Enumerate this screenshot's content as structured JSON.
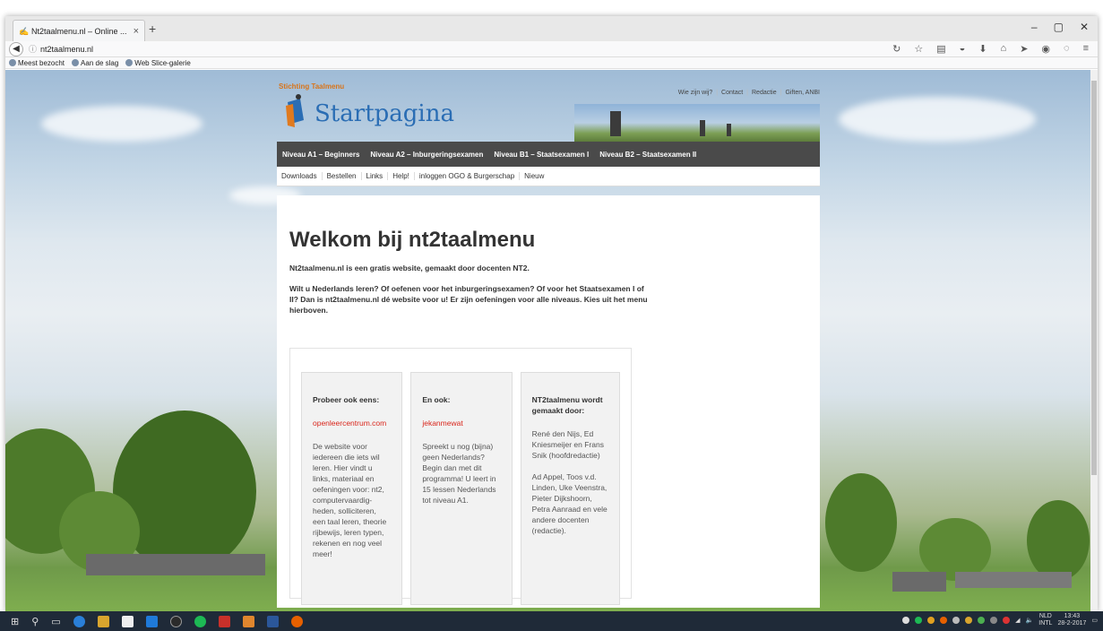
{
  "browser": {
    "tab_title": "Nt2taalmenu.nl – Online ...",
    "new_tab": "+",
    "url": "nt2taalmenu.nl",
    "window_controls": [
      "–",
      "▢",
      "✕"
    ],
    "bookmarks": [
      "Meest bezocht",
      "Aan de slag",
      "Web Slice-galerie"
    ]
  },
  "site": {
    "stichting": "Stichting Taalmenu",
    "logo": "Startpagina",
    "toplinks": [
      "Wie zijn wij?",
      "Contact",
      "Redactie",
      "Giften, ANBI"
    ],
    "mainnav": [
      "Niveau A1 – Beginners",
      "Niveau A2 – Inburgeringsexamen",
      "Niveau B1 – Staatsexamen I",
      "Niveau B2 – Staatsexamen II"
    ],
    "subnav": [
      "Downloads",
      "Bestellen",
      "Links",
      "Help!",
      "inloggen OGO & Burgerschap",
      "Nieuw"
    ],
    "heading": "Welkom bij nt2taalmenu",
    "intro": "Nt2taalmenu.nl is een gratis website, gemaakt door docenten NT2.",
    "intro2": "Wilt u Nederlands leren? Of oefenen voor het inburgeringsexamen? Of voor het Staatsexamen I of II? Dan is nt2taalmenu.nl dé website voor u! Er zijn oefeningen voor alle niveaus. Kies uit het menu hierboven.",
    "boxes": [
      {
        "title": "Probeer ook eens:",
        "link": "openleercentrum.com",
        "text": "De website voor iedereen die iets wil leren. Hier vindt u links, materiaal en oefeningen voor: nt2, computervaardig-heden, solliciteren, een taal leren, theorie rijbewijs, leren typen, rekenen en nog veel meer!"
      },
      {
        "title": "En ook:",
        "link": "jekanmewat",
        "text": "Spreekt u nog (bijna) geen Nederlands? Begin dan met dit programma! U leert in 15 lessen Nederlands tot niveau A1."
      },
      {
        "title": "NT2taalmenu wordt gemaakt door:",
        "text": "René den Nijs, Ed Kniesmeijer en Frans Snik (hoofdredactie)",
        "text2": "Ad Appel, Toos v.d. Linden, Uke Veenstra, Pieter Dijkshoorn, Petra Aanraad en vele andere docenten (redactie)."
      }
    ]
  },
  "taskbar": {
    "lang_top": "NLD",
    "lang_bottom": "INTL",
    "time": "13:43",
    "date": "28-2-2017"
  }
}
